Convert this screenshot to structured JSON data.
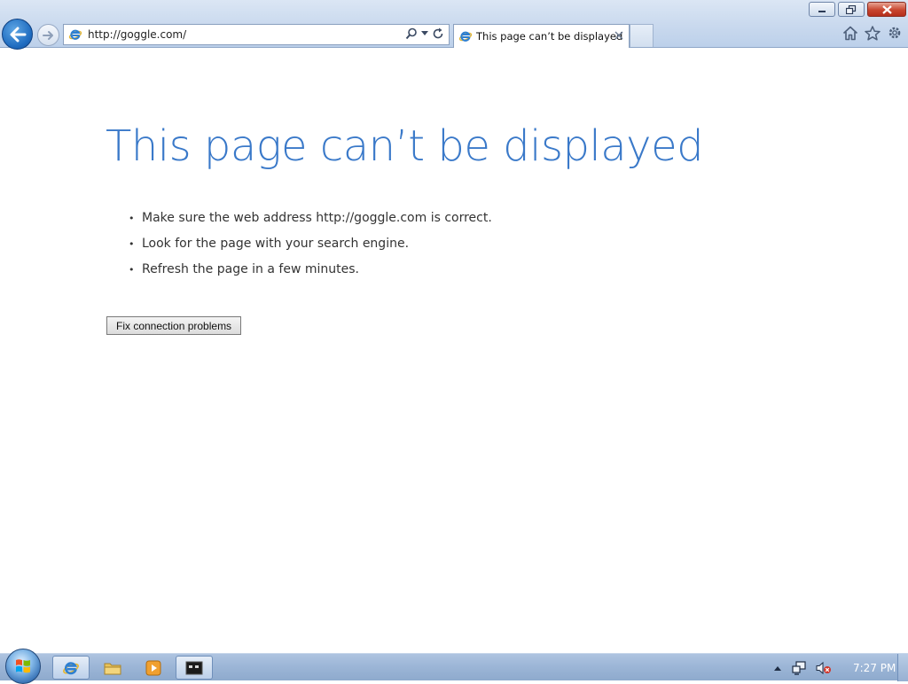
{
  "browser": {
    "address": "http://goggle.com/",
    "tab_title": "This page can’t be displayed",
    "window_controls": [
      "minimize-icon",
      "restore-icon",
      "close-icon"
    ],
    "command_icons": [
      "home-icon",
      "favorites-star-icon",
      "tools-gear-icon"
    ]
  },
  "page": {
    "title": "This page can’t be displayed",
    "suggestions": [
      "Make sure the web address http://goggle.com is correct.",
      "Look for the page with your search engine.",
      "Refresh the page in a few minutes."
    ],
    "fix_button_label": "Fix connection problems"
  },
  "taskbar": {
    "pinned": [
      "internet-explorer-icon",
      "file-explorer-icon",
      "media-player-icon",
      "terminal-icon"
    ],
    "clock": "7:27 PM"
  },
  "colors": {
    "title_blue": "#3a79c9",
    "back_button_blue": "#1f6cc0",
    "close_button_red": "#c8452f"
  }
}
